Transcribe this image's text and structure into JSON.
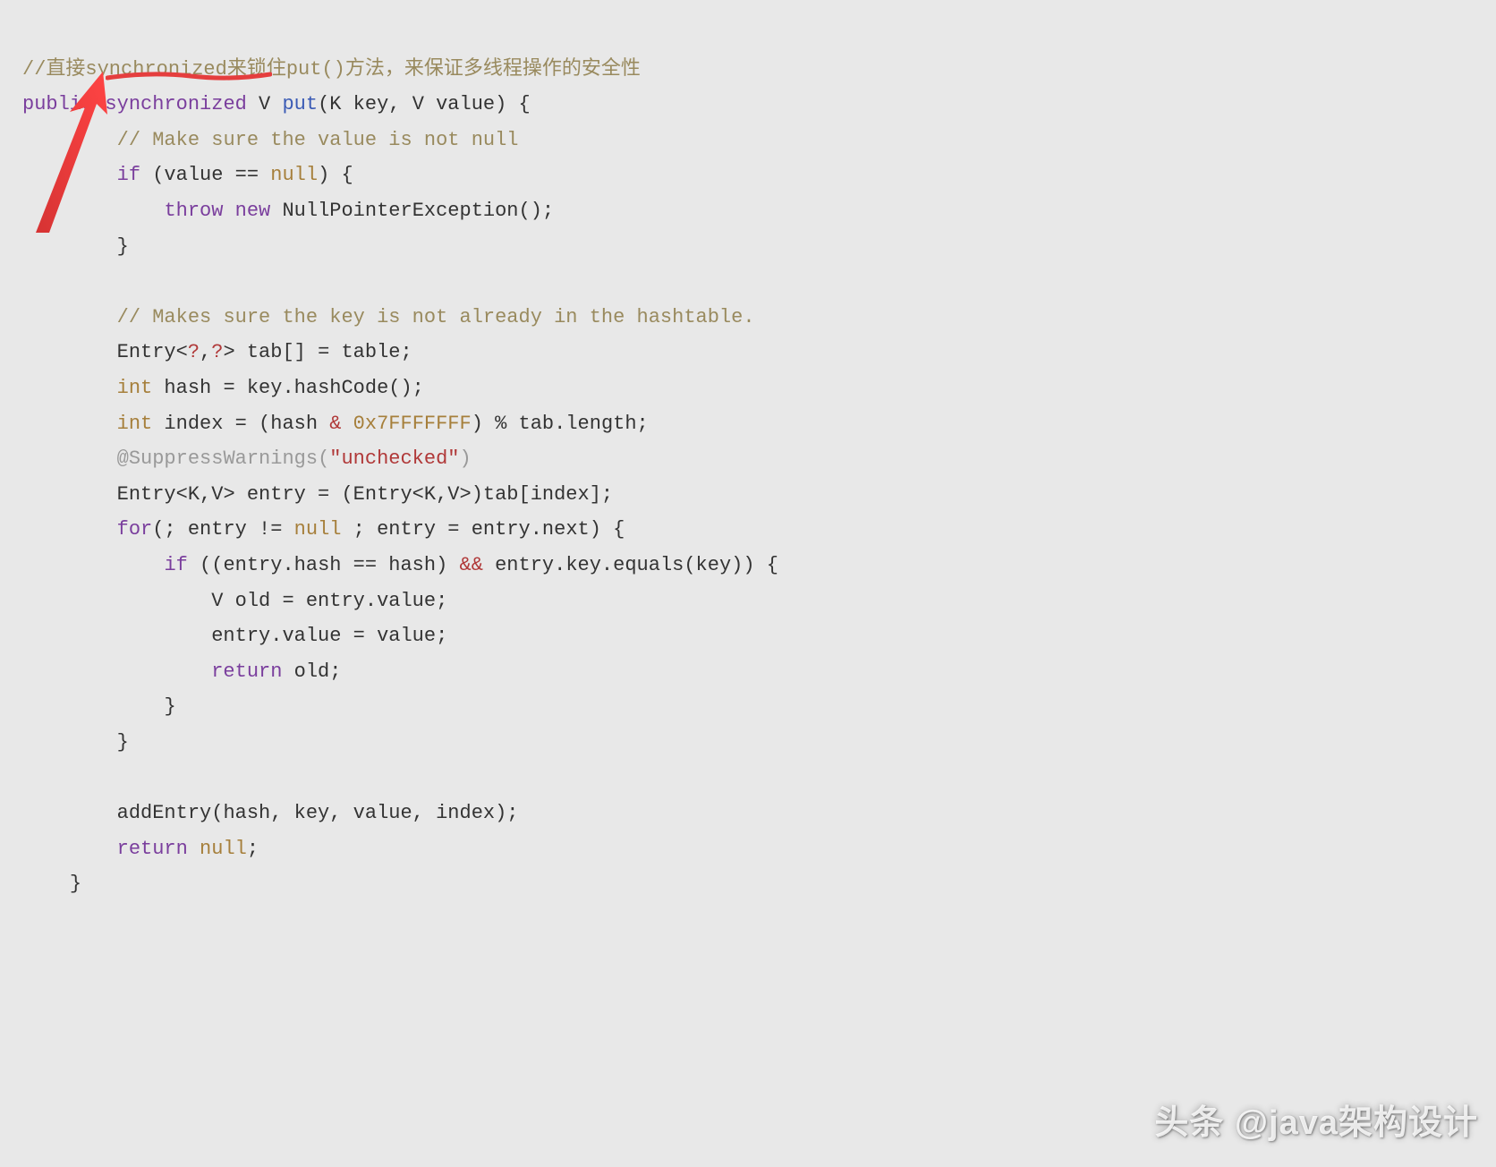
{
  "code": {
    "line1_comment": "//直接synchronized来锁住put()方法，来保证多线程操作的安全性",
    "line2_public": "public",
    "line2_sync": "synchronized",
    "line2_v": " V ",
    "line2_put": "put",
    "line2_params": "(K key, V value) {",
    "line3_comment": "// Make sure the value is not null",
    "line4_if": "if",
    "line4_cond": " (value == ",
    "line4_null": "null",
    "line4_brace": ") {",
    "line5_throw": "throw",
    "line5_new": "new",
    "line5_ex": " NullPointerException();",
    "line6_brace": "}",
    "line8_comment": "// Makes sure the key is not already in the hashtable.",
    "line9_entry": "Entry<",
    "line9_q1": "?",
    "line9_comma": ",",
    "line9_q2": "?",
    "line9_rest": "> tab[] = table;",
    "line10_int": "int",
    "line10_rest": " hash = key.hashCode();",
    "line11_int": "int",
    "line11_mid": " index = (hash ",
    "line11_amp": "&",
    "line11_hex": " 0x7FFFFFFF",
    "line11_rest": ") % tab.length;",
    "line12_supp": "@SuppressWarnings",
    "line12_paren": "(",
    "line12_str": "\"unchecked\"",
    "line12_close": ")",
    "line13": "Entry<K,V> entry = (Entry<K,V>)tab[index];",
    "line14_for": "for",
    "line14_p1": "(; entry != ",
    "line14_null": "null",
    "line14_rest": " ; entry = entry.next) {",
    "line15_if": "if",
    "line15_mid": " ((entry.hash == hash) ",
    "line15_and": "&&",
    "line15_rest": " entry.key.equals(key)) {",
    "line16": "V old = entry.value;",
    "line17": "entry.value = value;",
    "line18_ret": "return",
    "line18_rest": " old;",
    "line19_brace": "}",
    "line20_brace": "}",
    "line22": "addEntry(hash, key, value, index);",
    "line23_ret": "return",
    "line23_null": "null",
    "line23_semi": ";",
    "line24_brace": "}"
  },
  "watermark": "头条 @java架构设计",
  "indent1": "    ",
  "indent2": "        ",
  "indent3": "            ",
  "indent4": "                "
}
